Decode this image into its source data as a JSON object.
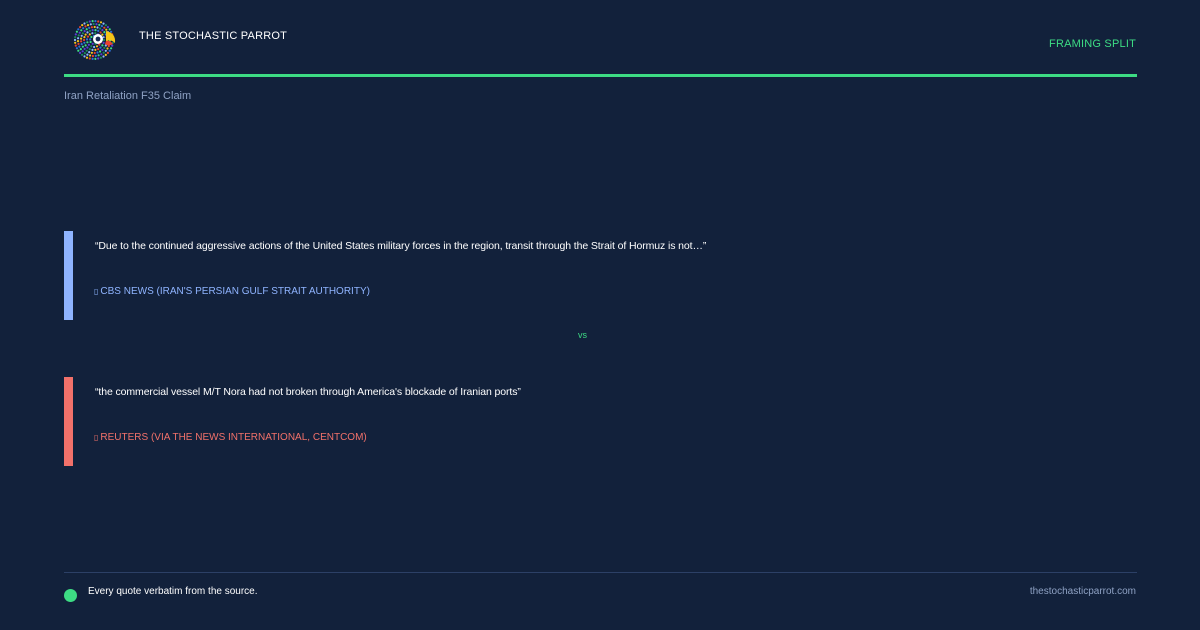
{
  "header": {
    "brand": "THE STOCHASTIC PARROT",
    "tag": "FRAMING SPLIT",
    "subtitle": "Iran Retaliation F35 Claim",
    "logo_icon": "parrot-logo-icon"
  },
  "quotes": [
    {
      "text": "“Due to the continued aggressive actions of the United States military forces in the region, transit through the Strait of Hormuz is not…”",
      "source": "CBS NEWS (IRAN'S PERSIAN GULF STRAIT AUTHORITY)",
      "source_icon": "source-icon",
      "color": "#8fb4ff"
    },
    {
      "text": "“the commercial vessel M/T Nora had not broken through America's blockade of Iranian ports”",
      "source": "REUTERS (VIA THE NEWS INTERNATIONAL, CENTCOM)",
      "source_icon": "source-icon",
      "color": "#f2716a"
    }
  ],
  "separator": "vs",
  "footer": {
    "note": "Every quote verbatim from the source.",
    "site": "thestochasticparrot.com"
  },
  "colors": {
    "background": "#12213b",
    "accent": "#3ddc84",
    "muted": "#8fa2c4"
  }
}
